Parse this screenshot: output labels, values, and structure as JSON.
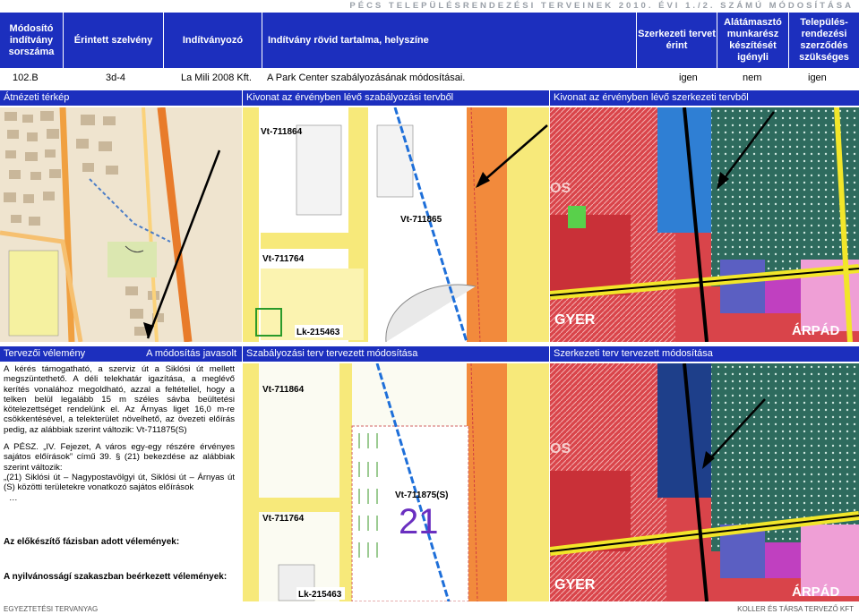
{
  "topbar": "PÉCS TELEPÜLÉSRENDEZÉSI TERVEINEK 2010. ÉVI 1./2. SZÁMÚ MÓDOSÍTÁSA",
  "header": {
    "col1": "Módosító indítvány sorszáma",
    "col2": "Érintett szelvény",
    "col3": "Indítványozó",
    "col4": "Indítvány rövid tartalma, helyszíne",
    "col5": "Szerkezeti tervet érint",
    "col6": "Alátámasztó munkarész készítését igényli",
    "col7": "Település-rendezési szerződés szükséges"
  },
  "row": {
    "id": "102.B",
    "sheet": "3d-4",
    "proposer": "La Mili 2008 Kft.",
    "content": "A Park Center szabályozásának módosításai.",
    "structural": "igen",
    "support": "nem",
    "contract": "igen"
  },
  "sections_top": {
    "overview": "Átnézeti térkép",
    "reg_extract": "Kivonat az érvényben lévő szabályozási tervből",
    "struct_extract": "Kivonat az érvényben lévő szerkezeti tervből"
  },
  "sections_bottom": {
    "opinion": "Tervezői vélemény",
    "proposed": "A módosítás javasolt",
    "reg_change": "Szabályozási terv tervezett módosítása",
    "struct_change": "Szerkezeti terv tervezett módosítása"
  },
  "opinion_text": {
    "p1": "A kérés támogatható, a szerviz út a Siklósi út mellett megszüntethető. A déli telekhatár igazítása, a meglévő kerítés vonalához megoldható, azzal a feltétellel, hogy a telken belül legalább 15 m széles sávba beültetési kötelezettséget rendelünk el. Az Árnyas liget 16,0 m-re csökkentésével, a telekterület növelhető, az övezeti előírás pedig, az alábbiak szerint változik: Vt-711875(S)",
    "p2": "A PÉSZ. „IV. Fejezet, A város egy-egy részére érvényes sajátos előírások” című 39. § (21) bekezdése az alábbiak szerint változik:",
    "p3": "„(21) Siklósi út – Nagypostavölgyi út, Siklósi út – Árnyas út (S) közötti területekre vonatkozó sajátos előírások",
    "p4": "…"
  },
  "prelim_label": "Az előkészítő fázisban adott vélemények:",
  "public_label": "A nyilvánosságí szakaszban beérkezett vélemények:",
  "map_labels": {
    "vt711864": "Vt-711864",
    "vt711865": "Vt-711865",
    "vt711764": "Vt-711764",
    "lk215463": "Lk-215463",
    "vt711875s": "Vt-711875(S)",
    "num21": "21",
    "os": "OS",
    "gyer": "GYER",
    "arpad": "ÁRPÁD"
  },
  "footer": {
    "left": "EGYEZTETÉSI TERVANYAG",
    "right": "KOLLER ÉS TÁRSA TERVEZŐ KFT"
  },
  "colors": {
    "header_blue": "#1c2fbe"
  }
}
